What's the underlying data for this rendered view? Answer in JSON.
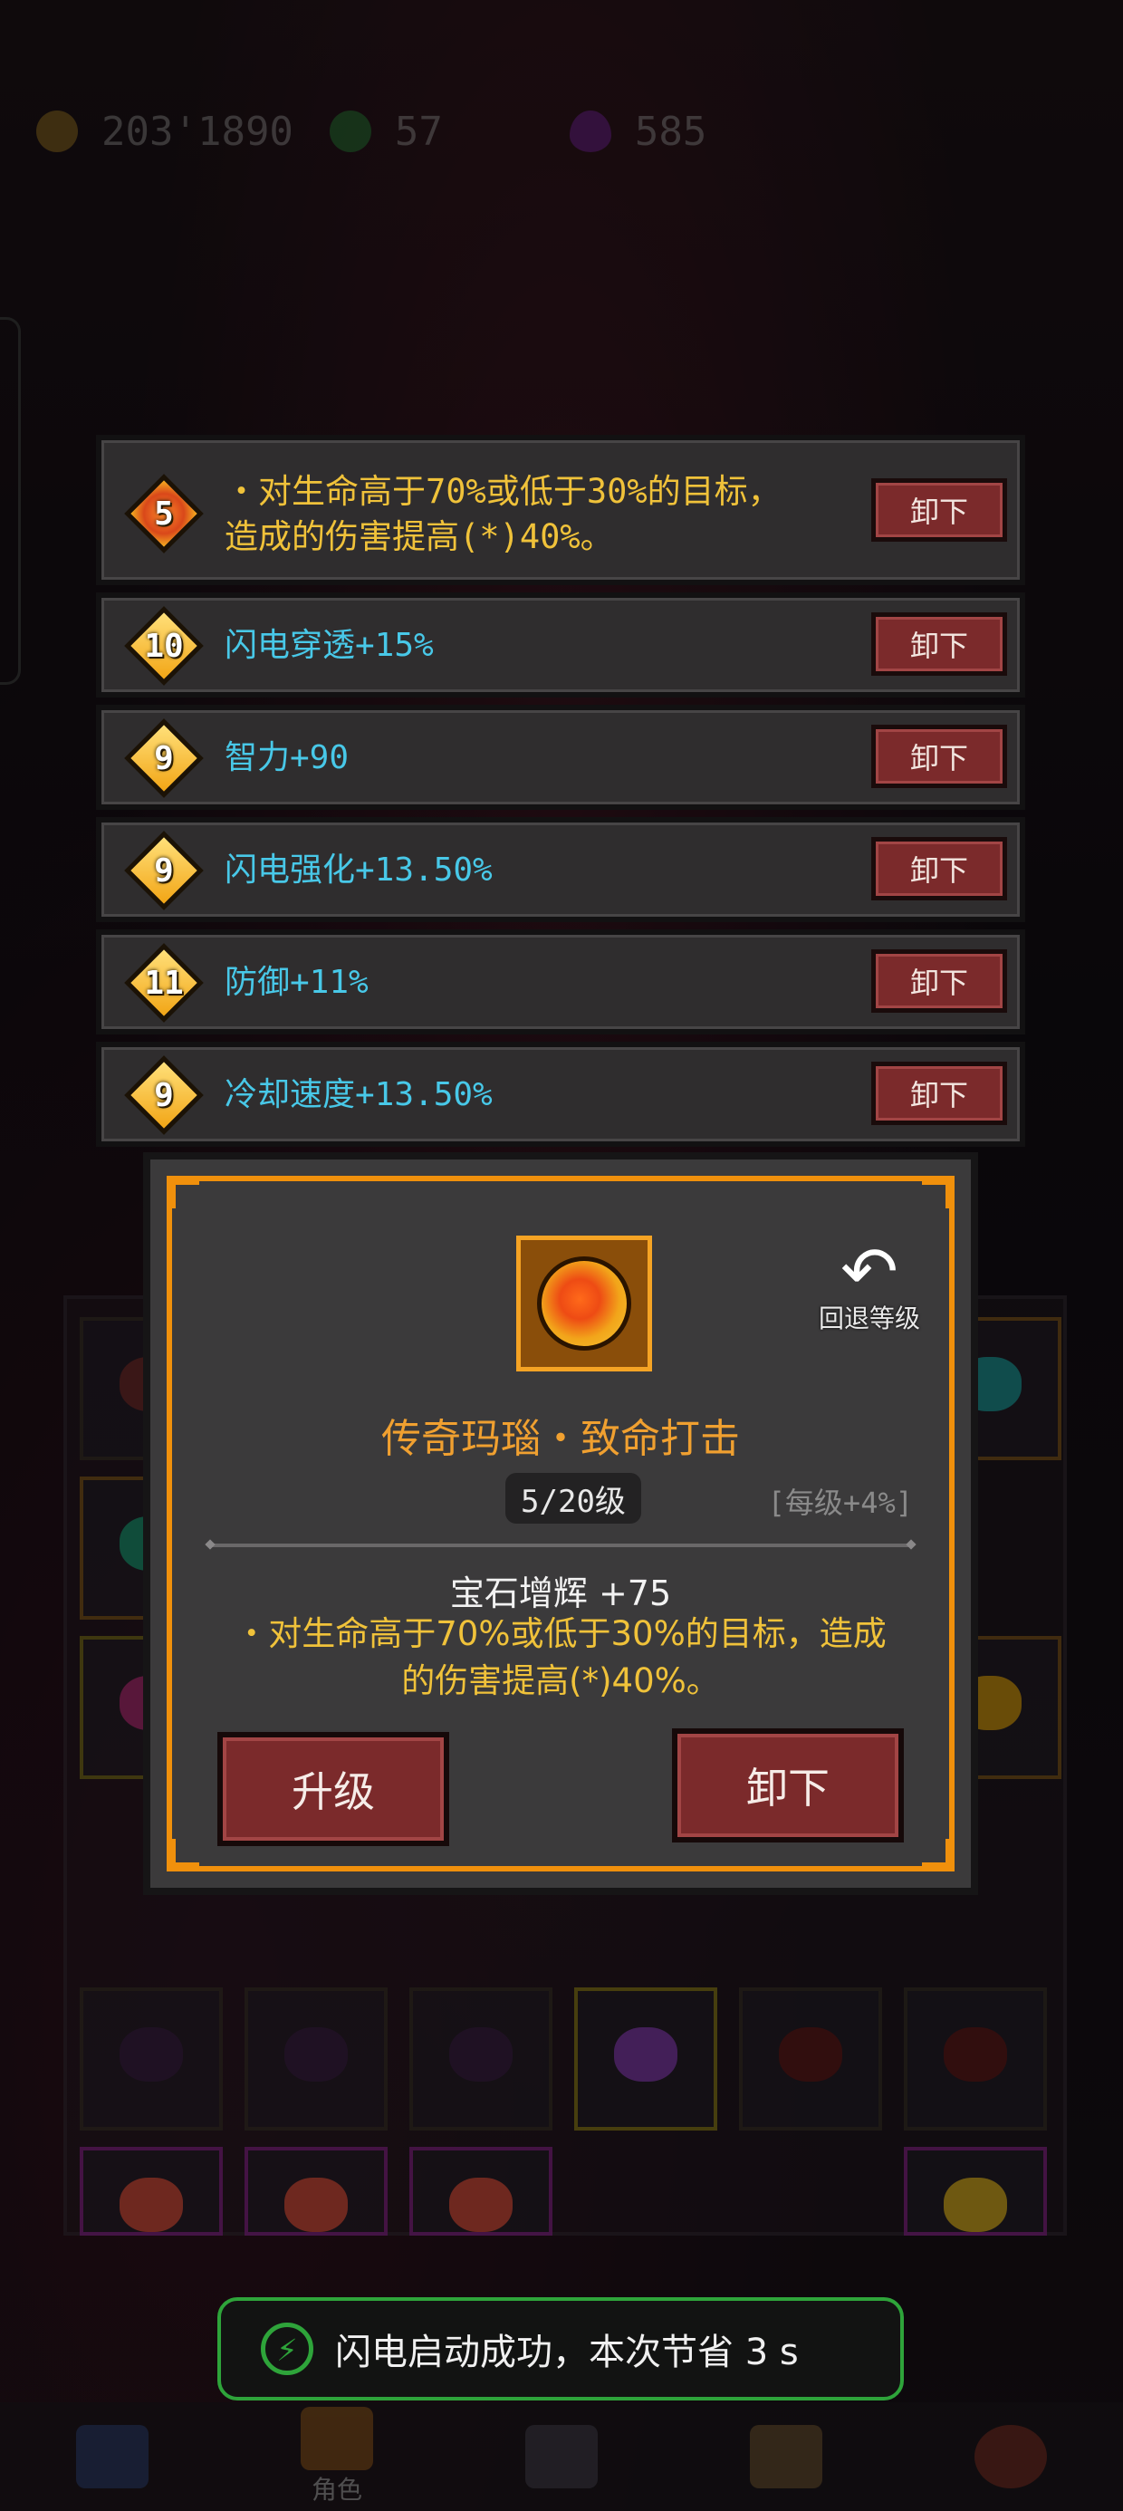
{
  "currency": {
    "gold": "203'1890",
    "gems": "57",
    "crystals": "585",
    "gold_icon": "gold-coin-icon",
    "gem_icon": "green-gem-icon",
    "crystal_icon": "purple-crystal-icon"
  },
  "slots": [
    {
      "level": "5",
      "type": "legendary",
      "text_line1": "・对生命高于70%或低于30%的目标，",
      "text_line2": "造成的伤害提高(*)40%。",
      "button": "卸下"
    },
    {
      "level": "10",
      "type": "normal",
      "text": "闪电穿透+15%",
      "button": "卸下"
    },
    {
      "level": "9",
      "type": "normal",
      "text": "智力+90",
      "button": "卸下"
    },
    {
      "level": "9",
      "type": "normal",
      "text": "闪电强化+13.50%",
      "button": "卸下"
    },
    {
      "level": "11",
      "type": "normal",
      "text": "防御+11%",
      "button": "卸下"
    },
    {
      "level": "9",
      "type": "normal",
      "text": "冷却速度+13.50%",
      "button": "卸下"
    }
  ],
  "detail": {
    "name": "传奇玛瑙・致命打击",
    "level": "5/20级",
    "per_level": "[每级+4%]",
    "bonus": "宝石增辉 +75",
    "desc_line1": "・对生命高于70%或低于30%的目标，造成",
    "desc_line2": "的伤害提高(*)40%。",
    "rollback": "回退等级",
    "upgrade": "升级",
    "unequip": "卸下"
  },
  "toast": {
    "message": "闪电启动成功，本次节省 3 s"
  },
  "nav": {
    "active_label": "角色"
  },
  "colors": {
    "accent_orange": "#f0900c",
    "stat_cyan": "#48c8e8",
    "legendary_gold": "#f0c23a",
    "button_red": "#7b2a2b",
    "toast_green": "#2ea43a"
  }
}
